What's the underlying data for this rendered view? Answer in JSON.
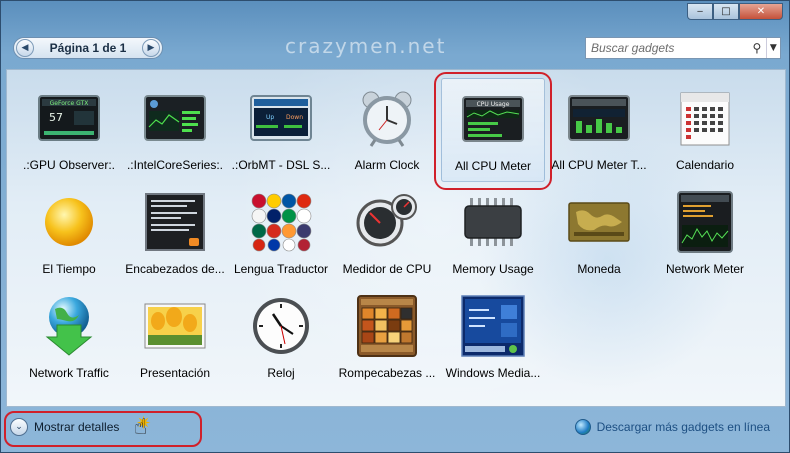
{
  "window": {
    "controls": {
      "minimize": "‒",
      "maximize": "□",
      "close": "✕"
    },
    "watermark": "crazymen.net"
  },
  "pager": {
    "label": "Página 1 de 1",
    "prev": "◀",
    "next": "▶"
  },
  "search": {
    "placeholder": "Buscar gadgets",
    "icon": "⚲",
    "dropdown": "▼"
  },
  "gadgets": [
    {
      "name": ".:GPU Observer:.",
      "icon": "gpu-observer-icon"
    },
    {
      "name": ".:IntelCoreSeries:.",
      "icon": "intel-core-series-icon"
    },
    {
      "name": ".:OrbMT - DSL S...",
      "icon": "orbmt-dsl-icon"
    },
    {
      "name": "Alarm Clock",
      "icon": "alarm-clock-icon"
    },
    {
      "name": "All CPU Meter",
      "icon": "cpu-meter-icon",
      "selected": true
    },
    {
      "name": "All CPU Meter T...",
      "icon": "cpu-meter-t-icon"
    },
    {
      "name": "Calendario",
      "icon": "calendar-icon"
    },
    {
      "name": "El Tiempo",
      "icon": "weather-sun-icon"
    },
    {
      "name": "Encabezados de...",
      "icon": "rss-headlines-icon"
    },
    {
      "name": "Lengua Traductor",
      "icon": "flags-translator-icon"
    },
    {
      "name": "Medidor de CPU",
      "icon": "cpu-gauge-icon"
    },
    {
      "name": "Memory Usage",
      "icon": "memory-chip-icon"
    },
    {
      "name": "Moneda",
      "icon": "currency-map-icon"
    },
    {
      "name": "Network Meter",
      "icon": "network-meter-icon"
    },
    {
      "name": "Network Traffic",
      "icon": "network-traffic-globe-icon"
    },
    {
      "name": "Presentación",
      "icon": "slideshow-tulips-icon"
    },
    {
      "name": "Reloj",
      "icon": "clock-icon"
    },
    {
      "name": "Rompecabezas ...",
      "icon": "puzzle-icon"
    },
    {
      "name": "Windows Media...",
      "icon": "windows-media-center-icon"
    }
  ],
  "footer": {
    "details_label": "Mostrar detalles",
    "details_chevron": "⌄",
    "online_link": "Descargar más gadgets en línea"
  },
  "colors": {
    "highlight": "#d0202a",
    "accent": "#1d4f82"
  }
}
